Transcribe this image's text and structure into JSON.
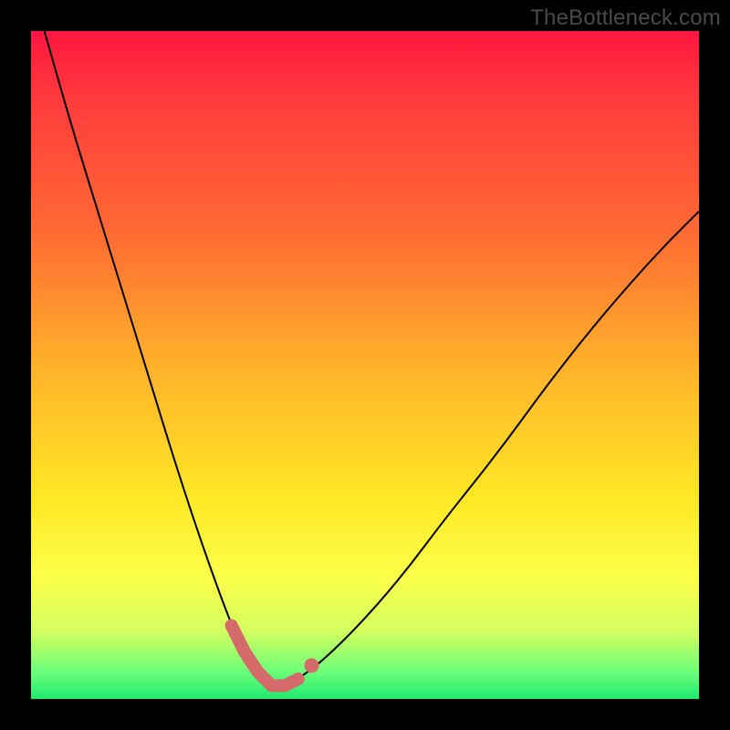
{
  "watermark": "TheBottleneck.com",
  "chart_data": {
    "type": "line",
    "title": "",
    "xlabel": "",
    "ylabel": "",
    "xlim": [
      0,
      100
    ],
    "ylim": [
      0,
      100
    ],
    "grid": false,
    "background_gradient_stops": [
      {
        "pos": 0,
        "color": "#ff1740"
      },
      {
        "pos": 0.1,
        "color": "#ff3a3c"
      },
      {
        "pos": 0.3,
        "color": "#ff6a33"
      },
      {
        "pos": 0.5,
        "color": "#ffb12a"
      },
      {
        "pos": 0.7,
        "color": "#ffe825"
      },
      {
        "pos": 0.82,
        "color": "#fbff4a"
      },
      {
        "pos": 0.9,
        "color": "#d2ff60"
      },
      {
        "pos": 0.96,
        "color": "#6bff7a"
      },
      {
        "pos": 1.0,
        "color": "#1fe96e"
      }
    ],
    "series": [
      {
        "name": "bottleneck-curve",
        "x": [
          2,
          6,
          10,
          14,
          18,
          22,
          26,
          30,
          32,
          34,
          36,
          38,
          40,
          44,
          50,
          56,
          62,
          70,
          78,
          86,
          94,
          100
        ],
        "y": [
          100,
          86,
          73,
          60,
          47,
          34,
          22,
          11,
          7,
          4,
          2,
          2,
          3,
          6,
          12,
          19,
          27,
          37,
          48,
          58,
          67,
          73
        ]
      }
    ],
    "highlight_segment": {
      "name": "optimal-range",
      "color": "#d46a6a",
      "x": [
        30,
        32,
        34,
        36,
        38,
        40
      ],
      "y": [
        11,
        7,
        4,
        2,
        2,
        3
      ]
    },
    "highlight_dot": {
      "x": 42,
      "y": 5
    }
  }
}
